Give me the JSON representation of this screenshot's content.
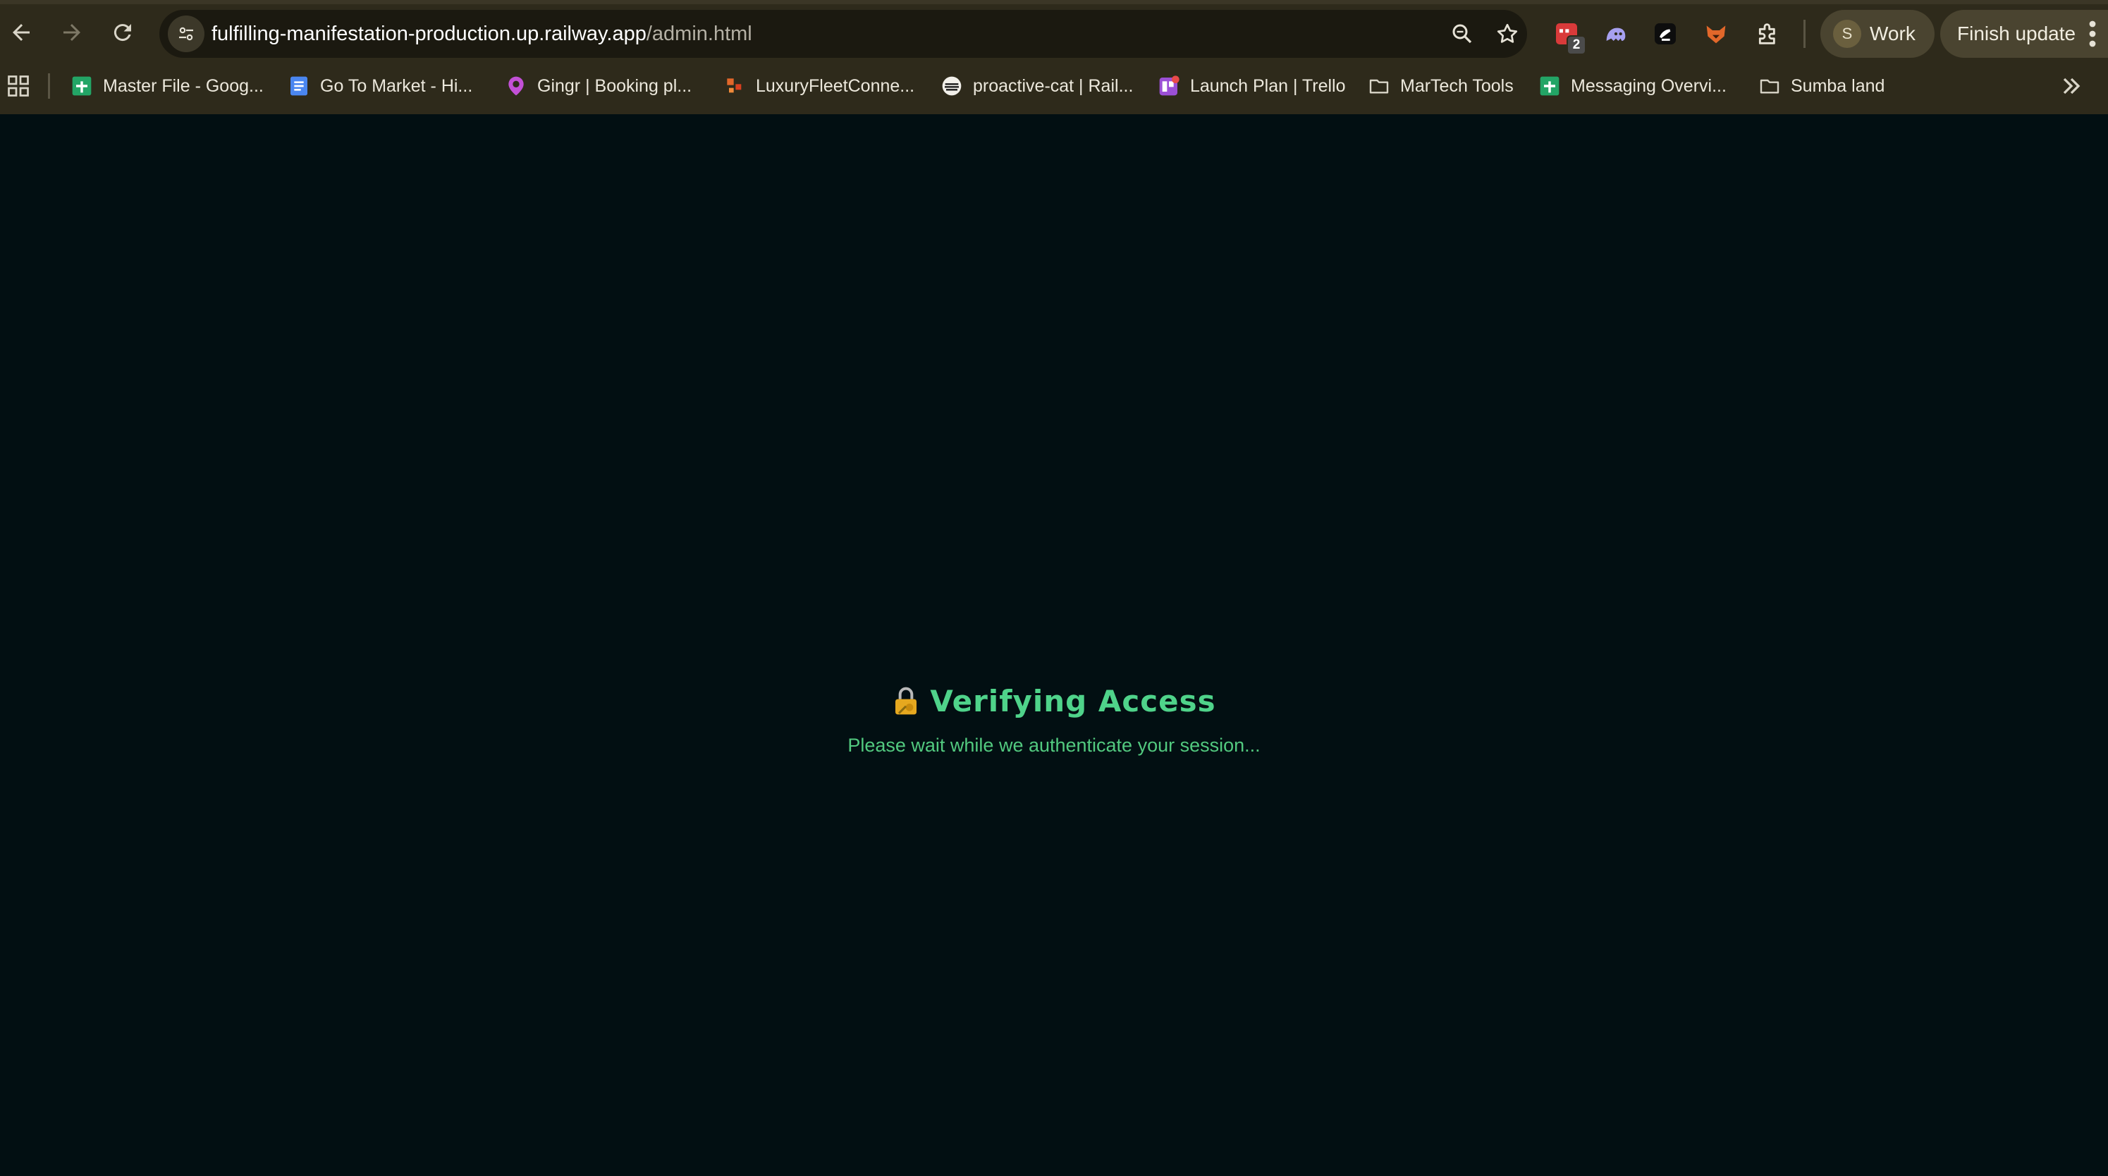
{
  "browser": {
    "url_host": "fulfilling-manifestation-production.up.railway.app",
    "url_path": "/admin.html",
    "extension_badge": "2",
    "profile": {
      "initial": "S",
      "label": "Work"
    },
    "update_label": "Finish update"
  },
  "bookmarks": [
    {
      "label": "Master File - Goog...",
      "icon": "google-sheets-icon"
    },
    {
      "label": "Go To Market - Hi...",
      "icon": "google-docs-icon"
    },
    {
      "label": "Gingr | Booking pl...",
      "icon": "gingr-icon"
    },
    {
      "label": "LuxuryFleetConne...",
      "icon": "luxury-fleet-icon"
    },
    {
      "label": "proactive-cat | Rail...",
      "icon": "railway-icon"
    },
    {
      "label": "Launch Plan | Trello",
      "icon": "trello-icon"
    },
    {
      "label": "MarTech Tools",
      "icon": "folder-icon"
    },
    {
      "label": "Messaging Overvi...",
      "icon": "google-sheets-icon"
    },
    {
      "label": "Sumba land",
      "icon": "folder-icon"
    }
  ],
  "main": {
    "title": "Verifying Access",
    "title_icon": "lock-key-icon",
    "subtitle": "Please wait while we authenticate your session..."
  },
  "colors": {
    "page_bg": "#020f12",
    "chrome_bg": "#2e2a1b",
    "accent_green": "#4fd38a"
  }
}
